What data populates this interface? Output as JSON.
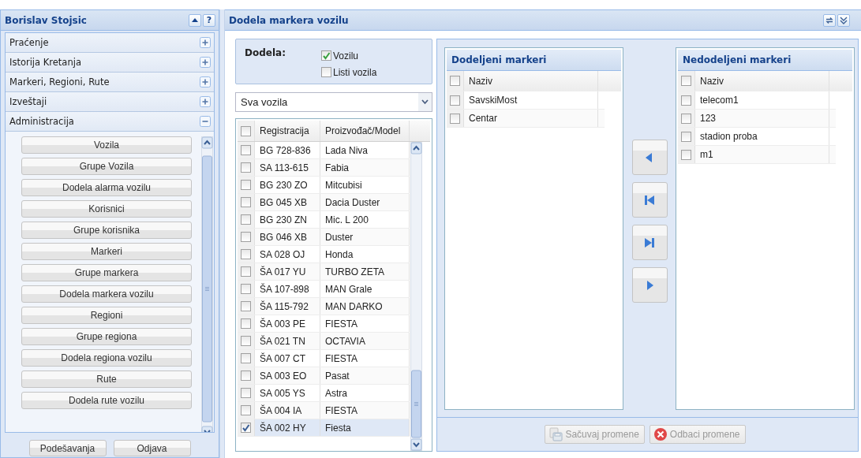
{
  "sidebar": {
    "title": "Borislav Stojsic",
    "help_label": "?",
    "sections": [
      {
        "label": "Praćenje",
        "expanded": false
      },
      {
        "label": "Istorija Kretanja",
        "expanded": false
      },
      {
        "label": "Markeri, Regioni, Rute",
        "expanded": false
      },
      {
        "label": "Izveštaji",
        "expanded": false
      },
      {
        "label": "Administracija",
        "expanded": true,
        "items": [
          "Vozila",
          "Grupe Vozila",
          "Dodela alarma vozilu",
          "Korisnici",
          "Grupe korisnika",
          "Markeri",
          "Grupe markera",
          "Dodela markera vozilu",
          "Regioni",
          "Grupe regiona",
          "Dodela regiona vozilu",
          "Rute",
          "Dodela rute vozilu"
        ]
      }
    ],
    "buttons": [
      "Podešavanja",
      "Odjava"
    ]
  },
  "main": {
    "title": "Dodela markera vozilu",
    "assignment": {
      "label": "Dodela:",
      "options": [
        {
          "label": "Vozilu",
          "checked": true
        },
        {
          "label": "Listi vozila",
          "checked": false
        }
      ]
    },
    "vehicle_filter": {
      "value": "Sva vozila"
    },
    "vehicles": {
      "columns": [
        "Registracija",
        "Proizvođač/Model"
      ],
      "all_checked": false,
      "rows": [
        {
          "registration": "BG 728-836",
          "model": "Lada Niva",
          "checked": false,
          "selected": false
        },
        {
          "registration": "SA 113-615",
          "model": "Fabia",
          "checked": false,
          "selected": false
        },
        {
          "registration": "BG 230 ZO",
          "model": "Mitcubisi",
          "checked": false,
          "selected": false
        },
        {
          "registration": "BG 045 XB",
          "model": "Dacia Duster",
          "checked": false,
          "selected": false
        },
        {
          "registration": "BG 230 ZN",
          "model": "Mic. L 200",
          "checked": false,
          "selected": false
        },
        {
          "registration": "BG 046 XB",
          "model": "Duster",
          "checked": false,
          "selected": false
        },
        {
          "registration": "SA 028 OJ",
          "model": "Honda",
          "checked": false,
          "selected": false
        },
        {
          "registration": "ŠA 017 YU",
          "model": "TURBO ZETA",
          "checked": false,
          "selected": false
        },
        {
          "registration": "ŠA 107-898",
          "model": "MAN Grale",
          "checked": false,
          "selected": false
        },
        {
          "registration": "ŠA 115-792",
          "model": "MAN DARKO",
          "checked": false,
          "selected": false
        },
        {
          "registration": "ŠA 003 PE",
          "model": "FIESTA",
          "checked": false,
          "selected": false
        },
        {
          "registration": "ŠA 021 TN",
          "model": "OCTAVIA",
          "checked": false,
          "selected": false
        },
        {
          "registration": "ŠA 007 CT",
          "model": "FIESTA",
          "checked": false,
          "selected": false
        },
        {
          "registration": "SA 003 EO",
          "model": "Pasat",
          "checked": false,
          "selected": false
        },
        {
          "registration": "SA 005 YS",
          "model": "Astra",
          "checked": false,
          "selected": false
        },
        {
          "registration": "ŠA 004 IA",
          "model": "FIESTA",
          "checked": false,
          "selected": false
        },
        {
          "registration": "ŠA 002 HY",
          "model": "Fiesta",
          "checked": true,
          "selected": true
        }
      ]
    },
    "assigned": {
      "title": "Dodeljeni markeri",
      "column": "Naziv",
      "all_checked": false,
      "rows": [
        {
          "name": "SavskiMost",
          "checked": false
        },
        {
          "name": "Centar",
          "checked": false
        }
      ]
    },
    "unassigned": {
      "title": "Nedodeljeni markeri",
      "column": "Naziv",
      "all_checked": false,
      "rows": [
        {
          "name": "telecom1",
          "checked": false
        },
        {
          "name": "123",
          "checked": false
        },
        {
          "name": "stadion proba",
          "checked": false
        },
        {
          "name": "m1",
          "checked": false
        }
      ]
    },
    "buttons": [
      {
        "kind": "save",
        "label": "Sačuvaj promene",
        "disabled": true
      },
      {
        "kind": "cancel",
        "label": "Odbaci promene",
        "disabled": true
      }
    ]
  }
}
